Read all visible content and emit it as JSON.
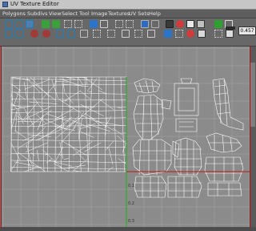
{
  "window": {
    "title": "UV Texture Editor"
  },
  "menu": [
    "Polygons",
    "Subdivs",
    "View",
    "Select",
    "Tool",
    "Image",
    "Textures",
    "UV Sets",
    "Help"
  ],
  "toolbar": {
    "zoom_value": "0.457"
  },
  "viewport": {
    "axis_labels": [
      "0.1",
      "0.2",
      "0.3"
    ]
  },
  "icons": [
    "move-uv-icon",
    "rotate-uv-icon",
    "scale-uv-icon",
    "flip-icon",
    "cut-uv-icon",
    "sew-uv-icon",
    "unfold-icon",
    "layout-icon",
    "grid-icon",
    "checker-icon",
    "color-icon",
    "isolate-icon"
  ],
  "colors": {
    "panel": "#686868",
    "viewport": "#8b8b8b",
    "grid": "#a6a6a6",
    "u_axis": "#c21515",
    "v_axis": "#15b515",
    "wire": "#ffffff"
  }
}
